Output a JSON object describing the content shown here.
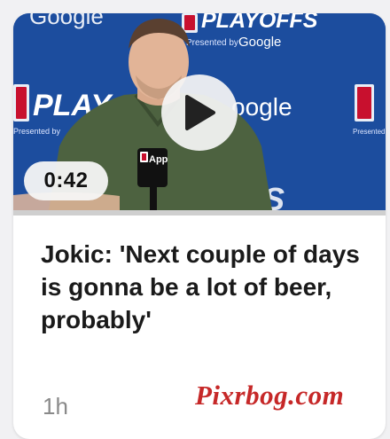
{
  "article": {
    "duration": "0:42",
    "headline": "Jokic: 'Next couple of days is gonna be a lot of beer, probably'",
    "age": "1h"
  },
  "backdrop": {
    "brand_google": "Google",
    "brand_google_partial": "oogle",
    "brand_playoffs": "PLAYOFFS",
    "brand_playoffs_partial": "PLAY",
    "presented_by": "Presented by",
    "mic_label": "App"
  },
  "watermark": "Pixrbog.com",
  "colors": {
    "backdrop_blue": "#1c4d9e",
    "shirt_green": "#4d6240",
    "watermark_red": "#c62828"
  },
  "icons": {
    "play": "play-icon"
  }
}
